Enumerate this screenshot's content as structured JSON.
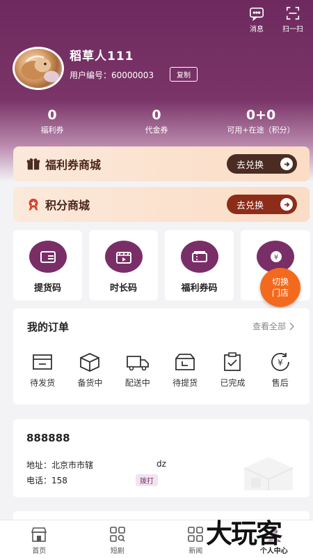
{
  "header": {
    "actions": [
      {
        "label": "消息",
        "icon": "message-icon"
      },
      {
        "label": "扫一扫",
        "icon": "scan-icon"
      }
    ]
  },
  "profile": {
    "name": "稻草人111",
    "user_id_label": "用户编号：60000003",
    "copy_label": "复制"
  },
  "stats": [
    {
      "value": "0",
      "label": "福利券"
    },
    {
      "value": "0",
      "label": "代金券"
    },
    {
      "value": "0+0",
      "label": "可用+在途（积分）"
    }
  ],
  "malls": [
    {
      "title": "福利券商城",
      "button": "去兑换",
      "icon": "gift-box-icon",
      "button_color": "#4a2c22"
    },
    {
      "title": "积分商城",
      "button": "去兑换",
      "icon": "medal-icon",
      "button_color": "#8e2c1a"
    }
  ],
  "tiles": [
    {
      "label": "提货码",
      "icon": "wallet-icon"
    },
    {
      "label": "时长码",
      "icon": "video-clapper-icon"
    },
    {
      "label": "福利券码",
      "icon": "ticket-icon"
    },
    {
      "label": "",
      "icon": "coin-yen-icon"
    }
  ],
  "switch_store": {
    "line1": "切换",
    "line2": "门店"
  },
  "orders": {
    "title": "我的订单",
    "view_all": "查看全部",
    "items": [
      {
        "label": "待发货",
        "icon": "pending-ship-icon"
      },
      {
        "label": "备货中",
        "icon": "box-icon"
      },
      {
        "label": "配送中",
        "icon": "truck-icon"
      },
      {
        "label": "待提货",
        "icon": "pickup-tray-icon"
      },
      {
        "label": "已完成",
        "icon": "clipboard-check-icon"
      },
      {
        "label": "售后",
        "icon": "yen-return-icon"
      }
    ]
  },
  "address": {
    "name": "888888",
    "addr_line": "地址：北京市市辖",
    "addr_extra": "dz",
    "phone_line": "电话：158",
    "call_label": "拨打"
  },
  "tabbar": [
    {
      "label": "首页",
      "icon": "home-store-icon"
    },
    {
      "label": "短剧",
      "icon": "grid-search-icon"
    },
    {
      "label": "新闻",
      "icon": "news-grid-icon"
    },
    {
      "label": "个人中心",
      "icon": "user-center-icon"
    }
  ],
  "watermark": "大玩客",
  "colors": {
    "brand": "#7a2e67",
    "accent": "#f36a1e"
  }
}
